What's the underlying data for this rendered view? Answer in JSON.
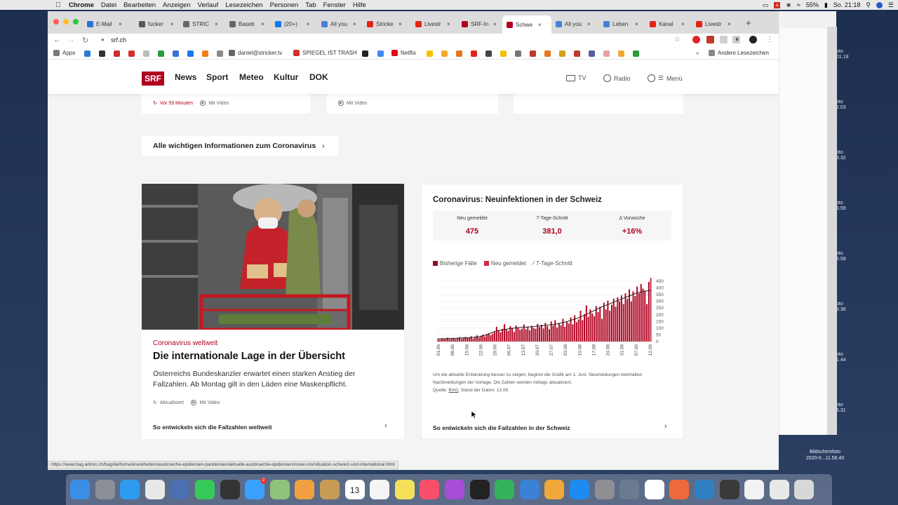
{
  "menubar": {
    "app": "Chrome",
    "items": [
      "Datei",
      "Bearbeiten",
      "Anzeigen",
      "Verlauf",
      "Lesezeichen",
      "Personen",
      "Tab",
      "Fenster",
      "Hilfe"
    ],
    "battery": "55%",
    "clock": "So. 21:18"
  },
  "tabs": [
    {
      "label": "E-Mail",
      "color": "#2f6fd6"
    },
    {
      "label": "fucker",
      "color": "#555555"
    },
    {
      "label": "STRIC",
      "color": "#666666"
    },
    {
      "label": "Baseb",
      "color": "#666666"
    },
    {
      "label": "(20+)",
      "color": "#1877f2"
    },
    {
      "label": "All you",
      "color": "#4a7fd8"
    },
    {
      "label": "Stricke",
      "color": "#e62117"
    },
    {
      "label": "Livestr",
      "color": "#e62117"
    },
    {
      "label": "SRF-In",
      "color": "#af001e"
    },
    {
      "label": "Schwe",
      "color": "#af001e",
      "active": true
    },
    {
      "label": "All you",
      "color": "#4a7fd8"
    },
    {
      "label": "Leben",
      "color": "#4a7fd8"
    },
    {
      "label": "Kanal",
      "color": "#e62117"
    },
    {
      "label": "Livestr",
      "color": "#e62117"
    }
  ],
  "toolbar": {
    "url": "srf.ch"
  },
  "bookmarks": {
    "apps": "Apps",
    "email": "daniel@stricker.tv",
    "spiegel": "SPIEGEL IST TRASH",
    "netflix": "Netflix",
    "other": "Andere Lesezeichen"
  },
  "srf": {
    "logo": "SRF",
    "nav": [
      "News",
      "Sport",
      "Meteo",
      "Kultur",
      "DOK"
    ],
    "tv": "TV",
    "radio": "Radio",
    "menu": "Menü"
  },
  "topcards": {
    "time": "Vor 59 Minuten",
    "video": "Mit Video",
    "video2": "Mit Video"
  },
  "infolink": "Alle wichtigen Informationen zum Coronavirus",
  "leftcard": {
    "kicker": "Coronavirus weltweit",
    "headline": "Die internationale Lage in der Übersicht",
    "teaser": "Österreichs Bundeskanzler erwartet einen starken Anstieg der Fallzahlen. Ab Montag gilt in den Läden eine Maskenpflicht.",
    "updated": "Aktualisiert",
    "video": "Mit Video",
    "cta": "So entwickeln sich die Fallzahlen weltweit"
  },
  "rightcard": {
    "title": "Coronavirus: Neuinfektionen in der Schweiz",
    "stats": [
      {
        "label": "Neu gemeldet",
        "value": "475"
      },
      {
        "label": "7-Tage-Schnitt",
        "value": "381,0"
      },
      {
        "label": "Δ Vorwoche",
        "value": "+16%"
      }
    ],
    "note": "Um die aktuelle Entwicklung besser zu zeigen, beginnt die Grafik am 1. Juni. Neumeldungen beinhalten Nachmeldungen der Vortage. Die Zahlen werden mittags aktualisiert.",
    "source_prefix": "Quelle: ",
    "source": "BAG",
    "source_suffix": ", Stand der Daten: 13.09.",
    "cta": "So entwickeln sich die Fallzahlen in der Schweiz"
  },
  "chart_data": {
    "type": "bar",
    "title": "",
    "legend": [
      "Bisherige Fälle",
      "Neu gemeldet",
      "7-Tage-Schnitt"
    ],
    "ylim": [
      0,
      450
    ],
    "yticks": [
      0,
      50,
      100,
      150,
      200,
      250,
      300,
      350,
      400,
      450
    ],
    "xticks": [
      "01.06",
      "08.06",
      "15.06",
      "22.06",
      "29.06",
      "06.07",
      "13.07",
      "20.07",
      "27.07",
      "03.08",
      "10.08",
      "17.08",
      "24.08",
      "31.08",
      "07.09",
      "12.09"
    ],
    "values": [
      20,
      15,
      25,
      18,
      22,
      30,
      17,
      24,
      28,
      19,
      26,
      33,
      21,
      29,
      35,
      27,
      31,
      40,
      22,
      37,
      46,
      30,
      42,
      52,
      38,
      55,
      62,
      48,
      60,
      72,
      110,
      85,
      70,
      95,
      130,
      90,
      80,
      115,
      100,
      72,
      120,
      105,
      88,
      96,
      128,
      92,
      110,
      84,
      118,
      102,
      95,
      132,
      108,
      126,
      98,
      140,
      115,
      92,
      150,
      120,
      160,
      105,
      138,
      122,
      170,
      110,
      150,
      135,
      180,
      128,
      196,
      145,
      165,
      230,
      160,
      205,
      270,
      185,
      240,
      210,
      190,
      265,
      220,
      260,
      170,
      290,
      240,
      305,
      230,
      275,
      320,
      260,
      330,
      300,
      345,
      280,
      360,
      318,
      390,
      300,
      375,
      340,
      410,
      360,
      430,
      395,
      380,
      280,
      445,
      475
    ],
    "series_avg": [
      22,
      21,
      22,
      23,
      24,
      26,
      27,
      28,
      30,
      33,
      38,
      45,
      55,
      68,
      80,
      85,
      90,
      95,
      100,
      103,
      106,
      108,
      110,
      112,
      115,
      118,
      122,
      126,
      130,
      135,
      142,
      150,
      160,
      170,
      182,
      195,
      210,
      225,
      240,
      255,
      268,
      280,
      292,
      305,
      318,
      330,
      342,
      355,
      365,
      372,
      378,
      381
    ]
  },
  "statusbar": "https://www.bag.admin.ch/bag/de/home/krankheiten/ausbrueche-epidemien-pandemien/aktuelle-ausbrueche-epidemien/novel-cov/situation-schweiz-und-international.html",
  "desktop": {
    "screenshot_label_1": "Bildschirmfoto",
    "screenshot_label_2": "2020-0...11.56.40",
    "side_labels": [
      "oto\n01.18",
      "oto\n2.03",
      "oto\n3.32",
      "oto\n3.59",
      "oto\n5.58",
      "oto\n9.36",
      "oto\n1.44",
      "oto\n6.31"
    ]
  },
  "dock": [
    {
      "name": "finder-icon",
      "color": "#3a8ee6"
    },
    {
      "name": "launchpad-icon",
      "color": "#8a8f98"
    },
    {
      "name": "safari-icon",
      "color": "#2e9bf0"
    },
    {
      "name": "chrome-icon",
      "color": "#e8e8e8"
    },
    {
      "name": "photos-capture-icon",
      "color": "#4b6fb0"
    },
    {
      "name": "facetime-icon",
      "color": "#37c85a"
    },
    {
      "name": "terminal-icon",
      "color": "#333333"
    },
    {
      "name": "messages-icon",
      "color": "#3aa0ff"
    },
    {
      "name": "maps-icon",
      "color": "#8fc27a"
    },
    {
      "name": "photos-icon",
      "color": "#f0a040"
    },
    {
      "name": "notes-box-icon",
      "color": "#c89b55"
    },
    {
      "name": "calendar-icon",
      "color": "#ffffff"
    },
    {
      "name": "reminders-icon",
      "color": "#f5f5f5"
    },
    {
      "name": "stickies-icon",
      "color": "#f5e05a"
    },
    {
      "name": "music-icon",
      "color": "#fa4f6a"
    },
    {
      "name": "podcasts-icon",
      "color": "#a64dd6"
    },
    {
      "name": "tv-icon",
      "color": "#222222"
    },
    {
      "name": "numbers-icon",
      "color": "#34b35a"
    },
    {
      "name": "keynote-icon",
      "color": "#3b82d6"
    },
    {
      "name": "pages-icon",
      "color": "#f0a83a"
    },
    {
      "name": "appstore-icon",
      "color": "#1e8bf0"
    },
    {
      "name": "settings-icon",
      "color": "#8e8e93"
    },
    {
      "name": "scanner-icon",
      "color": "#6a7a90"
    },
    {
      "name": "screenshot-tool-icon",
      "color": "#ffffff"
    },
    {
      "name": "app-icon",
      "color": "#ef6a3a"
    },
    {
      "name": "app-icon-2",
      "color": "#2f80c0"
    },
    {
      "name": "app-icon-3",
      "color": "#3a3a3a"
    },
    {
      "name": "documents-icon",
      "color": "#f2f2f2"
    },
    {
      "name": "folder-icon",
      "color": "#e8e8e8"
    },
    {
      "name": "trash-icon",
      "color": "#d8d8d8"
    }
  ],
  "calendar_day": "13",
  "messages_badge": "2",
  "colors": {
    "srf_red": "#af001e",
    "bar_red": "#af001e"
  }
}
